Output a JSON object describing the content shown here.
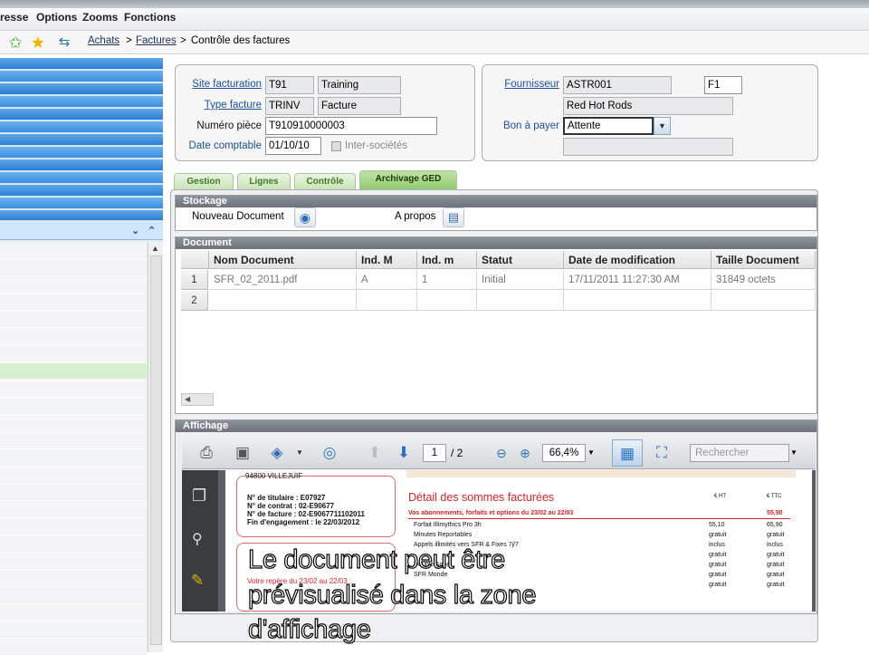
{
  "menu": {
    "items": [
      "resse",
      "Options",
      "Zooms",
      "Fonctions"
    ]
  },
  "breadcrumb": {
    "items": [
      "Achats",
      "Factures",
      "Contrôle des factures"
    ],
    "separator": ">"
  },
  "header_left": {
    "site_label": "Site facturation",
    "site_code": "T91",
    "site_name": "Training",
    "type_label": "Type facture",
    "type_code": "TRINV",
    "type_name": "Facture",
    "piece_label": "Numéro pièce",
    "piece_value": "T910910000003",
    "date_label": "Date comptable",
    "date_value": "01/10/10",
    "inter_label": "Inter-sociétés"
  },
  "header_right": {
    "fournisseur_label": "Fournisseur",
    "fournisseur_code": "ASTR001",
    "fournisseur_extra": "F1",
    "fournisseur_name": "Red Hot Rods",
    "bon_label": "Bon à payer",
    "bon_value": "Attente"
  },
  "tabs": [
    "Gestion",
    "Lignes",
    "Contrôle",
    "Archivage GED"
  ],
  "stockage": {
    "title": "Stockage",
    "new_doc": "Nouveau Document",
    "about": "A propos"
  },
  "document": {
    "title": "Document",
    "columns": [
      "Nom Document",
      "Ind. M",
      "Ind. m",
      "Statut",
      "Date de modification",
      "Taille Document"
    ],
    "rows": [
      {
        "num": "1",
        "name": "SFR_02_2011.pdf",
        "ind_m": "A",
        "ind_mm": "1",
        "statut": "Initial",
        "date": "17/11/2011 11:27:30 AM",
        "taille": "31849 octets"
      },
      {
        "num": "2",
        "name": "",
        "ind_m": "",
        "ind_mm": "",
        "statut": "",
        "date": "",
        "taille": ""
      }
    ]
  },
  "affichage": {
    "title": "Affichage",
    "page_current": "1",
    "page_total": "/ 2",
    "zoom": "66,4%",
    "search_placeholder": "Rechercher"
  },
  "pdf": {
    "address": "94800 VILLEJUIF",
    "titulaire": "N° de titulaire : E07927",
    "contrat": "N° de contrat : 02-E90677",
    "facture": "N° de facture : 02-E9067711102011",
    "engagement": "Fin d'engagement : le 22/03/2012",
    "repere": "Votre repère du 23/02 au 22/03 :",
    "detail_title": "Détail des sommes facturées",
    "ht": "€ HT",
    "ttc": "€ TTC",
    "abos": "Vos abonnements, forfaits et options du 23/02 au 22/03",
    "abos_total": "55,90",
    "lines": [
      {
        "label": "Forfait Illimythics Pro 3h",
        "ht": "55,10",
        "ttc": "65,90"
      },
      {
        "label": "Minutes Reportables",
        "ht": "gratuit",
        "ttc": "gratuit"
      },
      {
        "label": "Appels illimités vers SFR & Fixes 7j/7",
        "ht": "inclus",
        "ttc": "inclus"
      },
      {
        "label": "",
        "ht": "gratuit",
        "ttc": "gratuit"
      },
      {
        "label": "Double Appel",
        "ht": "gratuit",
        "ttc": "gratuit"
      },
      {
        "label": "SFR Monde",
        "ht": "gratuit",
        "ttc": "gratuit"
      },
      {
        "label": "",
        "ht": "gratuit",
        "ttc": "gratuit"
      }
    ]
  },
  "caption": {
    "line1": "Le document peut être",
    "line2": "prévisualisé dans la zone",
    "line3": "d'affichage"
  },
  "colors": {
    "accent_blue": "#2b7fd1",
    "tab_green": "#8fc86b",
    "link_blue": "#1b4f9c",
    "pdf_red": "#d4232a"
  }
}
